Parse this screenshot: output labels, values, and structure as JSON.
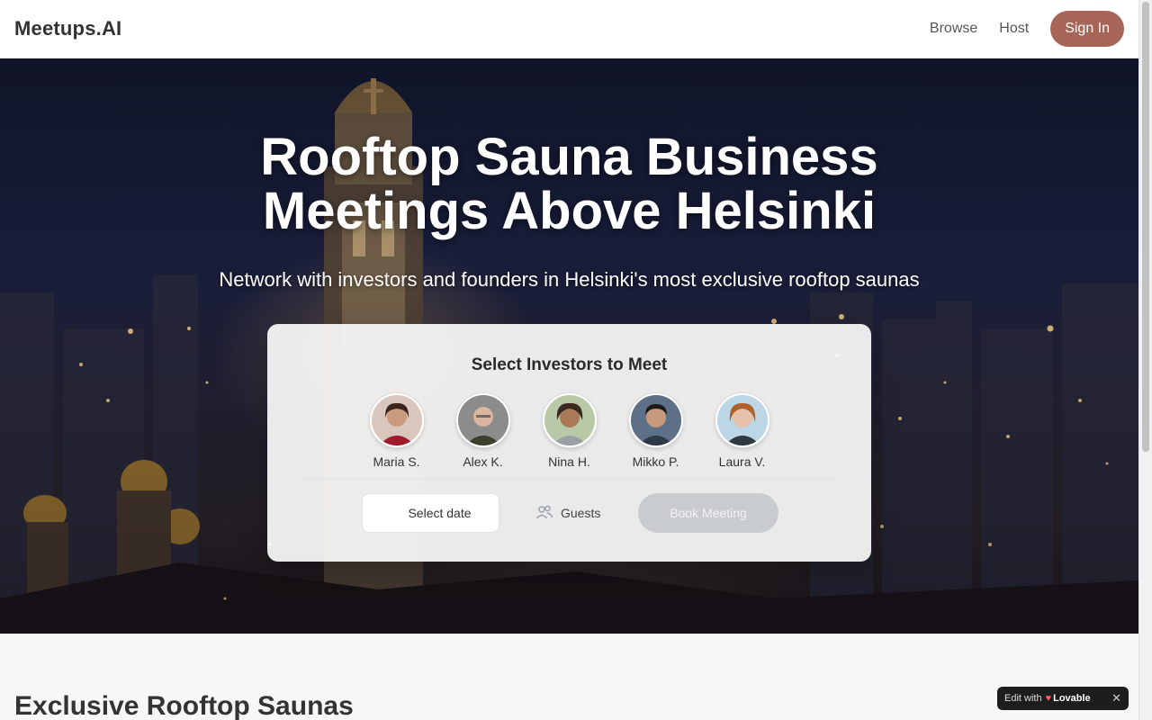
{
  "header": {
    "logo": "Meetups.AI",
    "nav": [
      "Browse",
      "Host"
    ],
    "signin_label": "Sign In"
  },
  "hero": {
    "title_line1": "Rooftop Sauna Business",
    "title_line2": "Meetings Above Helsinki",
    "subtitle": "Network with investors and founders in Helsinki's most exclusive rooftop saunas"
  },
  "booking": {
    "title": "Select Investors to Meet",
    "investors": [
      {
        "name": "Maria S."
      },
      {
        "name": "Alex K."
      },
      {
        "name": "Nina H."
      },
      {
        "name": "Mikko P."
      },
      {
        "name": "Laura V."
      }
    ],
    "date_label": "Select date",
    "guests_label": "Guests",
    "book_label": "Book Meeting"
  },
  "section": {
    "title": "Exclusive Rooftop Saunas"
  },
  "badge": {
    "edit_with": "Edit with",
    "brand": "Lovable",
    "close": "✕"
  },
  "colors": {
    "accent": "#a66556",
    "disabled_button": "#c9cccf"
  }
}
